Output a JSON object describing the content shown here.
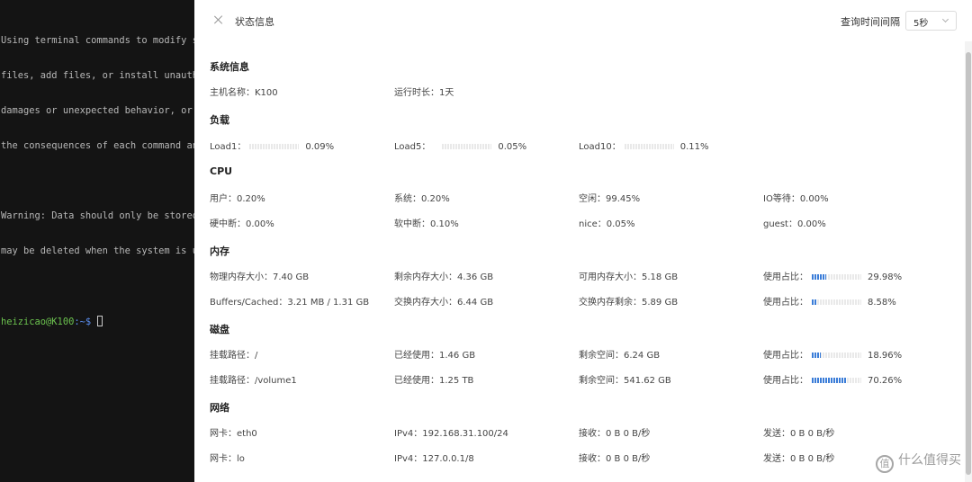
{
  "terminal": {
    "lines": [
      "Using terminal commands to modify syste",
      "files, add files, or install unauthoriz",
      "damages or unexpected behavior, or caus",
      "the consequences of each command and pr",
      "",
      "Warning: Data should only be stored in ",
      "may be deleted when the system is updat",
      ""
    ],
    "prompt_user": "heizicao@K100",
    "prompt_path": ":~$"
  },
  "header": {
    "title": "状态信息",
    "interval_label": "查询时间间隔",
    "interval_value": "5秒"
  },
  "sections": {
    "system": {
      "title": "系统信息",
      "hostname": "主机名称：K100",
      "uptime": "运行时长：1天"
    },
    "load": {
      "title": "负载",
      "load1": {
        "label": "Load1：",
        "value": "0.09%",
        "level": 0.0009
      },
      "load5": {
        "label": "Load5：",
        "value": "0.05%",
        "level": 0.0005
      },
      "load10": {
        "label": "Load10：",
        "value": "0.11%",
        "level": 0.0011
      }
    },
    "cpu": {
      "title": "CPU",
      "user": "用户：0.20%",
      "system": "系统：0.20%",
      "idle": "空闲：99.45%",
      "iowait": "IO等待：0.00%",
      "hardirq": "硬中断：0.00%",
      "softirq": "软中断：0.10%",
      "nice": "nice：0.05%",
      "guest": "guest：0.00%"
    },
    "memory": {
      "title": "内存",
      "physical": "物理内存大小：7.40 GB",
      "free": "剩余内存大小：4.36 GB",
      "available": "可用内存大小：5.18 GB",
      "usage_label": "使用占比：",
      "usage_value": "29.98%",
      "usage_level": 0.2998,
      "buffers": "Buffers/Cached：3.21 MB / 1.31 GB",
      "swap_total": "交换内存大小：6.44 GB",
      "swap_free": "交换内存剩余：5.89 GB",
      "swap_usage_label": "使用占比：",
      "swap_usage_value": "8.58%",
      "swap_usage_level": 0.0858
    },
    "disk": {
      "title": "磁盘",
      "rows": [
        {
          "mount": "挂载路径：/",
          "used": "已经使用：1.46 GB",
          "free": "剩余空间：6.24 GB",
          "usage_label": "使用占比：",
          "usage_value": "18.96%",
          "usage_level": 0.1896
        },
        {
          "mount": "挂载路径：/volume1",
          "used": "已经使用：1.25 TB",
          "free": "剩余空间：541.62 GB",
          "usage_label": "使用占比：",
          "usage_value": "70.26%",
          "usage_level": 0.7026
        }
      ]
    },
    "network": {
      "title": "网络",
      "rows": [
        {
          "nic": "网卡：eth0",
          "ipv4": "IPv4：192.168.31.100/24",
          "rx": "接收：0 B   0 B/秒",
          "tx": "发送：0 B   0 B/秒"
        },
        {
          "nic": "网卡：lo",
          "ipv4": "IPv4：127.0.0.1/8",
          "rx": "接收：0 B   0 B/秒",
          "tx": "发送：0 B   0 B/秒"
        }
      ]
    }
  },
  "watermark": {
    "icon_text": "值",
    "text": "什么值得买"
  },
  "colors": {
    "bar_fill": "#3b7dd8",
    "bar_track": "#e9e9e9",
    "prompt_user": "#6cc34f",
    "prompt_path": "#5b8ff0"
  },
  "icons": {
    "close": "close-icon",
    "chevron": "chevron-down-icon"
  }
}
